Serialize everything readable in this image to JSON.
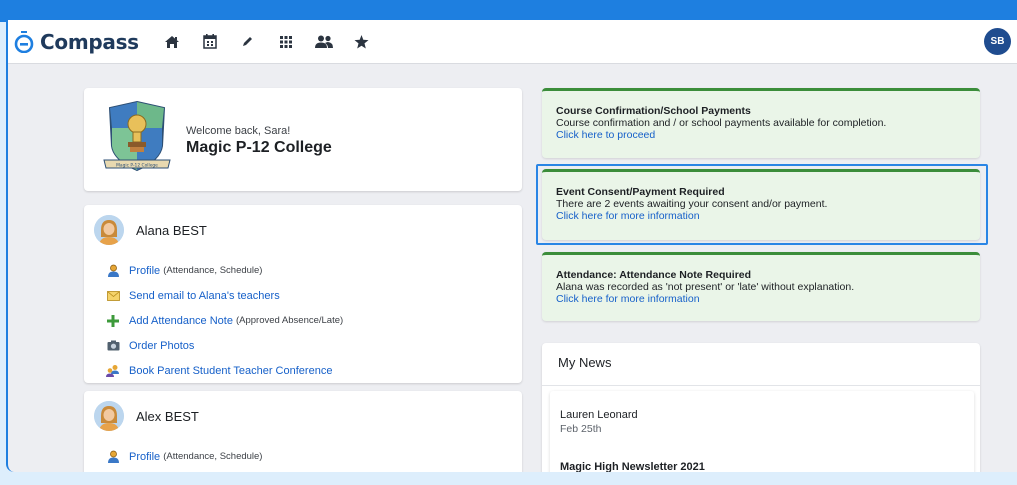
{
  "app": {
    "name": "Compass",
    "user_initials": "SB"
  },
  "nav": {
    "icons": [
      "home-icon",
      "calendar-icon",
      "pencil-icon",
      "apps-grid-icon",
      "people-icon",
      "star-icon"
    ]
  },
  "school": {
    "welcome": "Welcome back, Sara!",
    "name": "Magic P-12 College",
    "crest_banner": "Magic P-12 College"
  },
  "students": [
    {
      "name": "Alana BEST",
      "links": [
        {
          "label": "Profile",
          "note": "(Attendance, Schedule)",
          "icon": "profile-icon"
        },
        {
          "label": "Send email to Alana's teachers",
          "note": "",
          "icon": "email-icon"
        },
        {
          "label": "Add Attendance Note",
          "note": "(Approved Absence/Late)",
          "icon": "plus-icon"
        },
        {
          "label": "Order Photos",
          "note": "",
          "icon": "camera-icon"
        },
        {
          "label": "Book Parent Student Teacher Conference",
          "note": "",
          "icon": "conference-icon"
        }
      ]
    },
    {
      "name": "Alex BEST",
      "links": [
        {
          "label": "Profile",
          "note": "(Attendance, Schedule)",
          "icon": "profile-icon"
        }
      ]
    }
  ],
  "alerts": [
    {
      "title": "Course Confirmation/School Payments",
      "desc": "Course confirmation and / or school payments available for completion.",
      "link": "Click here to proceed"
    },
    {
      "title": "Event Consent/Payment Required",
      "desc": "There are 2 events awaiting your consent and/or payment.",
      "link": "Click here for more information"
    },
    {
      "title": "Attendance: Attendance Note Required",
      "desc": "Alana was recorded as 'not present' or 'late' without explanation.",
      "link": "Click here for more information"
    }
  ],
  "news": {
    "title": "My News",
    "author": "Lauren Leonard",
    "date": "Feb 25th",
    "headline": "Magic High Newsletter 2021"
  },
  "colors": {
    "frame": "#1e7fe0",
    "link": "#1660c9",
    "alert_bg": "#eaf5e8",
    "alert_border": "#3b8d3a",
    "highlight": "#2a85e5"
  }
}
